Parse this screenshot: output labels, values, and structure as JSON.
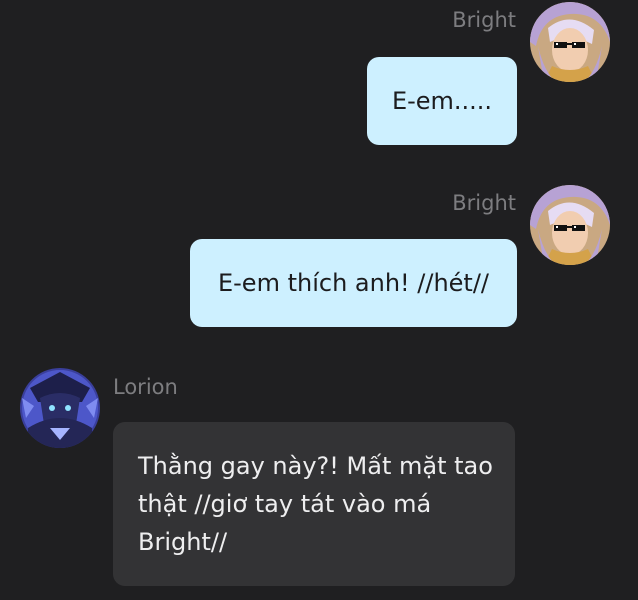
{
  "messages": [
    {
      "sender": "Bright",
      "text": "E-em.....",
      "avatar_icon": "bright-avatar-icon",
      "direction": "outgoing"
    },
    {
      "sender": "Bright",
      "text": "E-em thích anh! //hét//",
      "avatar_icon": "bright-avatar-icon",
      "direction": "outgoing"
    },
    {
      "sender": "Lorion",
      "text": "Thằng gay này?! Mất mặt tao thật //giơ tay tát vào má Bright//",
      "avatar_icon": "lorion-avatar-icon",
      "direction": "incoming"
    }
  ],
  "colors": {
    "background": "#1f1f21",
    "outgoing_bubble": "#cdf0ff",
    "incoming_bubble": "#333335",
    "name_text": "#7d7d80"
  }
}
